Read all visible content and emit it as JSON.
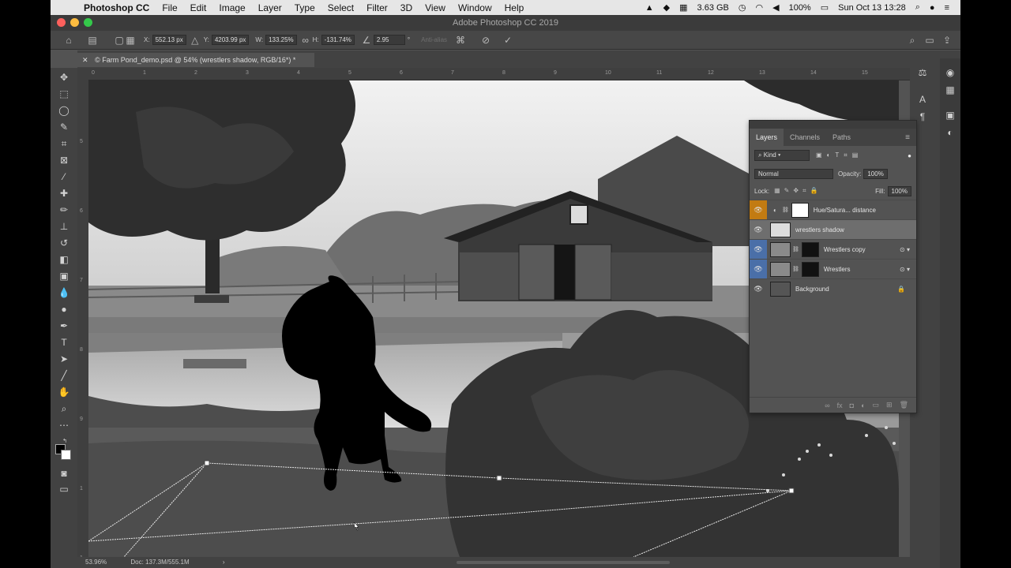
{
  "menubar": {
    "app": "Photoshop CC",
    "items": [
      "File",
      "Edit",
      "Image",
      "Layer",
      "Type",
      "Select",
      "Filter",
      "3D",
      "View",
      "Window",
      "Help"
    ],
    "memory": "3.63 GB",
    "battery": "100%",
    "datetime": "Sun Oct 13  13:28"
  },
  "window": {
    "title": "Adobe Photoshop CC 2019"
  },
  "options": {
    "x_label": "X:",
    "x_value": "552.13 px",
    "y_label": "Y:",
    "y_value": "4203.99 px",
    "w_label": "W:",
    "w_value": "133.25%",
    "h_label": "H:",
    "h_value": "-131.74%",
    "angle_value": "2.95",
    "angle_unit": "°",
    "antialias": "Anti-alias"
  },
  "document": {
    "tab": "© Farm Pond_demo.psd @ 54% (wrestlers shadow, RGB/16*) *"
  },
  "status": {
    "zoom": "53.96%",
    "doc": "Doc: 137.3M/555.1M"
  },
  "ruler": {
    "h_ticks": [
      "0",
      "1",
      "2",
      "3",
      "4",
      "5",
      "6",
      "7",
      "8",
      "9",
      "10",
      "11",
      "12",
      "13",
      "14",
      "15"
    ],
    "v_ticks": [
      "5",
      "6",
      "7",
      "8",
      "9",
      "1",
      "1"
    ]
  },
  "layers_panel": {
    "tabs": [
      "Layers",
      "Channels",
      "Paths"
    ],
    "filter_kind": "Kind",
    "blend_mode": "Normal",
    "opacity_label": "Opacity:",
    "opacity_value": "100%",
    "lock_label": "Lock:",
    "fill_label": "Fill:",
    "fill_value": "100%",
    "layers": [
      {
        "name": "Hue/Satura... distance",
        "type": "adjustment"
      },
      {
        "name": "wrestlers shadow",
        "type": "pixel",
        "selected": true
      },
      {
        "name": "Wrestlers copy",
        "type": "masked"
      },
      {
        "name": "Wrestlers",
        "type": "masked"
      },
      {
        "name": "Background",
        "type": "background"
      }
    ]
  }
}
